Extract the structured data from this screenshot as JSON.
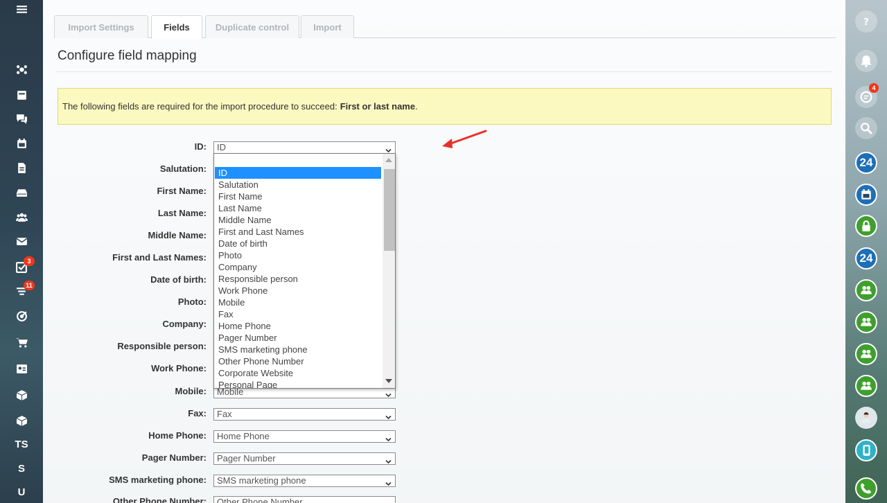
{
  "tabs": [
    "Import Settings",
    "Fields",
    "Duplicate control",
    "Import"
  ],
  "active_tab": "Fields",
  "page_title": "Configure field mapping",
  "notice": {
    "text": "The following fields are required for the import procedure to succeed:",
    "bold": "First or last name",
    "end": "."
  },
  "fields": [
    {
      "label": "ID:",
      "value": "ID"
    },
    {
      "label": "Salutation:",
      "value": ""
    },
    {
      "label": "First Name:",
      "value": ""
    },
    {
      "label": "Last Name:",
      "value": ""
    },
    {
      "label": "Middle Name:",
      "value": ""
    },
    {
      "label": "First and Last Names:",
      "value": ""
    },
    {
      "label": "Date of birth:",
      "value": ""
    },
    {
      "label": "Photo:",
      "value": ""
    },
    {
      "label": "Company:",
      "value": ""
    },
    {
      "label": "Responsible person:",
      "value": ""
    },
    {
      "label": "Work Phone:",
      "value": ""
    },
    {
      "label": "Mobile:",
      "value": "Mobile"
    },
    {
      "label": "Fax:",
      "value": "Fax"
    },
    {
      "label": "Home Phone:",
      "value": "Home Phone"
    },
    {
      "label": "Pager Number:",
      "value": "Pager Number"
    },
    {
      "label": "SMS marketing phone:",
      "value": "SMS marketing phone"
    },
    {
      "label": "Other Phone Number:",
      "value": "Other Phone Number"
    }
  ],
  "dropdown": {
    "options": [
      "",
      "ID",
      "Salutation",
      "First Name",
      "Last Name",
      "Middle Name",
      "First and Last Names",
      "Date of birth",
      "Photo",
      "Company",
      "Responsible person",
      "Work Phone",
      "Mobile",
      "Fax",
      "Home Phone",
      "Pager Number",
      "SMS marketing phone",
      "Other Phone Number",
      "Corporate Website",
      "Personal Page"
    ],
    "selected": "ID"
  },
  "left_nav": [
    {
      "icon": "menu-icon"
    },
    {
      "icon": "sites-icon"
    },
    {
      "icon": "feed-icon"
    },
    {
      "icon": "chat-icon"
    },
    {
      "icon": "calendar-icon"
    },
    {
      "icon": "document-icon"
    },
    {
      "icon": "drive-icon"
    },
    {
      "icon": "employees-icon"
    },
    {
      "icon": "mail-icon"
    },
    {
      "icon": "tasks-icon",
      "badge": "3"
    },
    {
      "icon": "crm-icon",
      "badge": "11"
    },
    {
      "icon": "target-icon"
    },
    {
      "icon": "cart-icon"
    },
    {
      "icon": "contact-card-icon"
    },
    {
      "icon": "box-icon"
    },
    {
      "icon": "box-icon"
    },
    {
      "text": "TS"
    },
    {
      "text": "S"
    },
    {
      "text": "U"
    }
  ],
  "right_nav": [
    {
      "icon": "help-icon"
    },
    {
      "icon": "bell-icon"
    },
    {
      "icon": "chat-bubble-icon",
      "badge": "4"
    },
    {
      "icon": "search-icon"
    },
    {
      "text": "24",
      "style": "blue"
    },
    {
      "icon": "calendar-icon",
      "style": "blue"
    },
    {
      "icon": "lock-icon",
      "style": "green"
    },
    {
      "text": "24",
      "style": "blue"
    },
    {
      "icon": "group-icon",
      "style": "green"
    },
    {
      "icon": "group-icon",
      "style": "green"
    },
    {
      "icon": "group-icon",
      "style": "green"
    },
    {
      "icon": "group-icon",
      "style": "green"
    },
    {
      "icon": "avatar-icon",
      "style": "photo"
    },
    {
      "icon": "phone-call-icon",
      "style": "teal"
    },
    {
      "icon": "phone-icon",
      "style": "green"
    }
  ],
  "colors": {
    "accent_blue": "#1e90ff",
    "notice_bg": "#fbf8c0",
    "badge_red": "#f0371b",
    "annotation_arrow": "#e8302b"
  }
}
